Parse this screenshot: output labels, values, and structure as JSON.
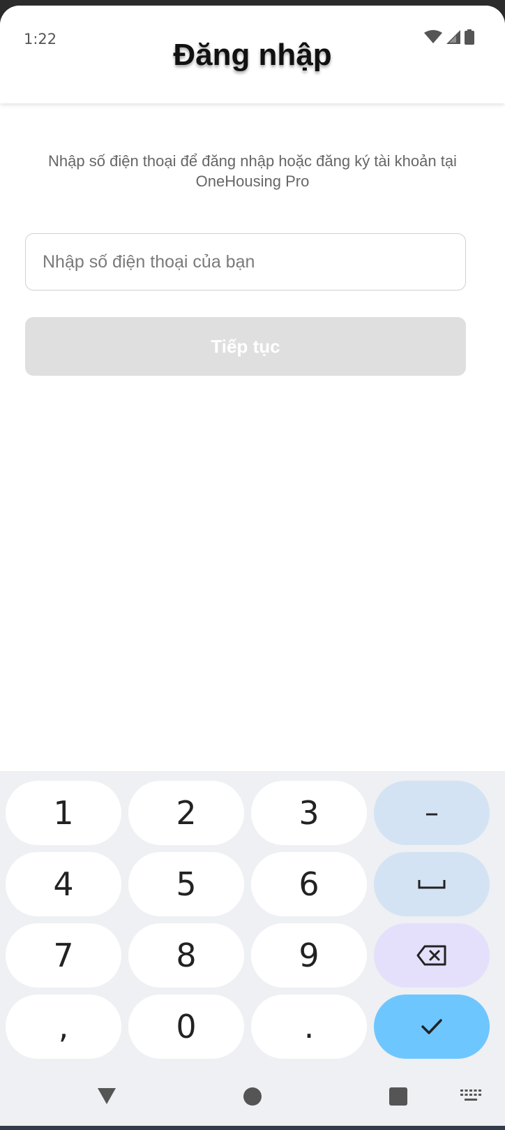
{
  "status_bar": {
    "time": "1:22",
    "icons": [
      "wifi-icon",
      "cellular-signal-icon",
      "battery-icon"
    ]
  },
  "header": {
    "title": "Đăng nhập"
  },
  "main": {
    "description": "Nhập số điện thoại để đăng nhập hoặc đăng ký tài khoản tại OneHousing Pro",
    "phone_input": {
      "value": "",
      "placeholder": "Nhập số điện thoại của bạn"
    },
    "continue_label": "Tiếp tục"
  },
  "keyboard": {
    "rows": [
      [
        "1",
        "2",
        "3",
        "-"
      ],
      [
        "4",
        "5",
        "6",
        "space"
      ],
      [
        "7",
        "8",
        "9",
        "backspace"
      ],
      [
        ",",
        "0",
        ".",
        "done"
      ]
    ],
    "digit_keys": {
      "k1": "1",
      "k2": "2",
      "k3": "3",
      "k4": "4",
      "k5": "5",
      "k6": "6",
      "k7": "7",
      "k8": "8",
      "k9": "9",
      "comma": ",",
      "k0": "0",
      "period": "."
    },
    "dash_label": "–"
  },
  "nav_bar": {
    "icons": [
      "back-triangle-icon",
      "home-circle-icon",
      "recents-square-icon",
      "keyboard-switch-icon"
    ]
  },
  "colors": {
    "continue_disabled": "#dfdfdf",
    "key_func": "#d3e3f3",
    "key_delete": "#e4e0fb",
    "key_done": "#6ec6ff",
    "keyboard_bg": "#eef0f3"
  }
}
